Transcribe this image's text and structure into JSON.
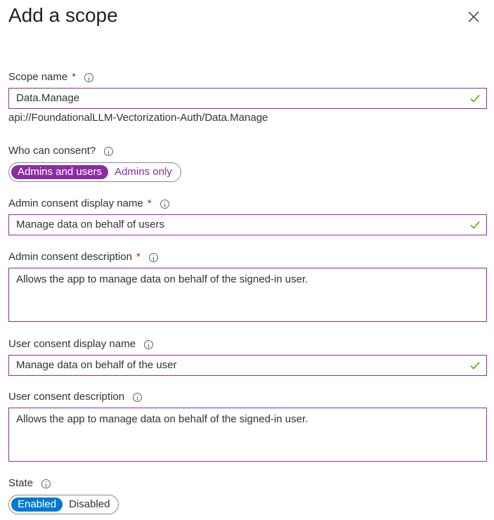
{
  "panel": {
    "title": "Add a scope"
  },
  "scope_name": {
    "label": "Scope name",
    "required_mark": "*",
    "value": "Data.Manage",
    "uri": "api://FoundationalLLM-Vectorization-Auth/Data.Manage"
  },
  "who_can_consent": {
    "label": "Who can consent?",
    "options": [
      "Admins and users",
      "Admins only"
    ],
    "selected": "Admins and users"
  },
  "admin_display_name": {
    "label": "Admin consent display name",
    "required_mark": "*",
    "value": "Manage data on behalf of users"
  },
  "admin_description": {
    "label": "Admin consent description",
    "required_mark": "*",
    "value": "Allows the app to manage data on behalf of the signed-in user."
  },
  "user_display_name": {
    "label": "User consent display name",
    "value": "Manage data on behalf of the user"
  },
  "user_description": {
    "label": "User consent description",
    "value": "Allows the app to manage data on behalf of the signed-in user."
  },
  "state": {
    "label": "State",
    "options": [
      "Enabled",
      "Disabled"
    ],
    "selected": "Enabled"
  },
  "colors": {
    "accent": "#8a2da5",
    "enabled_blue": "#0078d4",
    "valid_check": "#57a300",
    "required": "#a4262c"
  },
  "icons": {
    "close": "close-icon",
    "info": "info-icon",
    "valid": "checkmark-icon"
  }
}
